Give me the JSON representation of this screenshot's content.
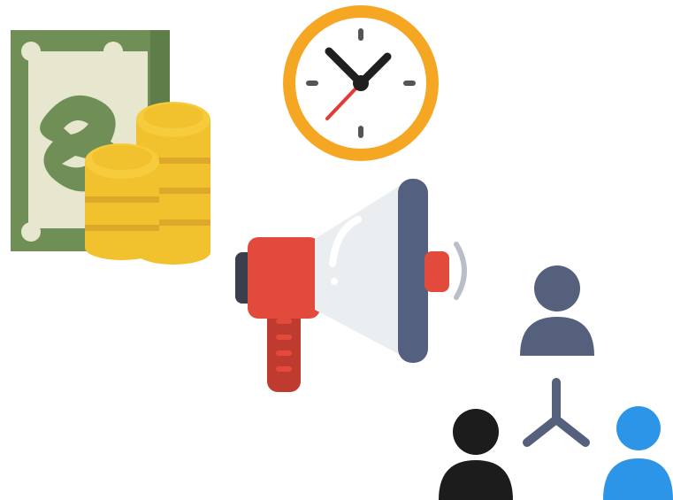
{
  "scene": {
    "icons": [
      {
        "name": "money-icon",
        "depicts": "banknote-and-coins"
      },
      {
        "name": "clock-icon",
        "depicts": "clock"
      },
      {
        "name": "megaphone-icon",
        "depicts": "megaphone"
      },
      {
        "name": "people-network-icon",
        "depicts": "three-people-connected"
      }
    ],
    "colors": {
      "background": "#ffffff",
      "banknote_green": "#6f8f57",
      "banknote_inner": "#e7e6cf",
      "coin_gold": "#f2c12e",
      "coin_shadow": "#dea92a",
      "clock_ring": "#f5a623",
      "clock_hands": "#1f1f1f",
      "second_hand": "#e53935",
      "megaphone_red": "#e24a3b",
      "megaphone_body": "#ebeef1",
      "megaphone_rim": "#53607f",
      "megaphone_handle": "#bf3b30",
      "person_slate": "#55607c",
      "person_black": "#1c1c1c",
      "person_blue": "#2d95e8"
    }
  }
}
